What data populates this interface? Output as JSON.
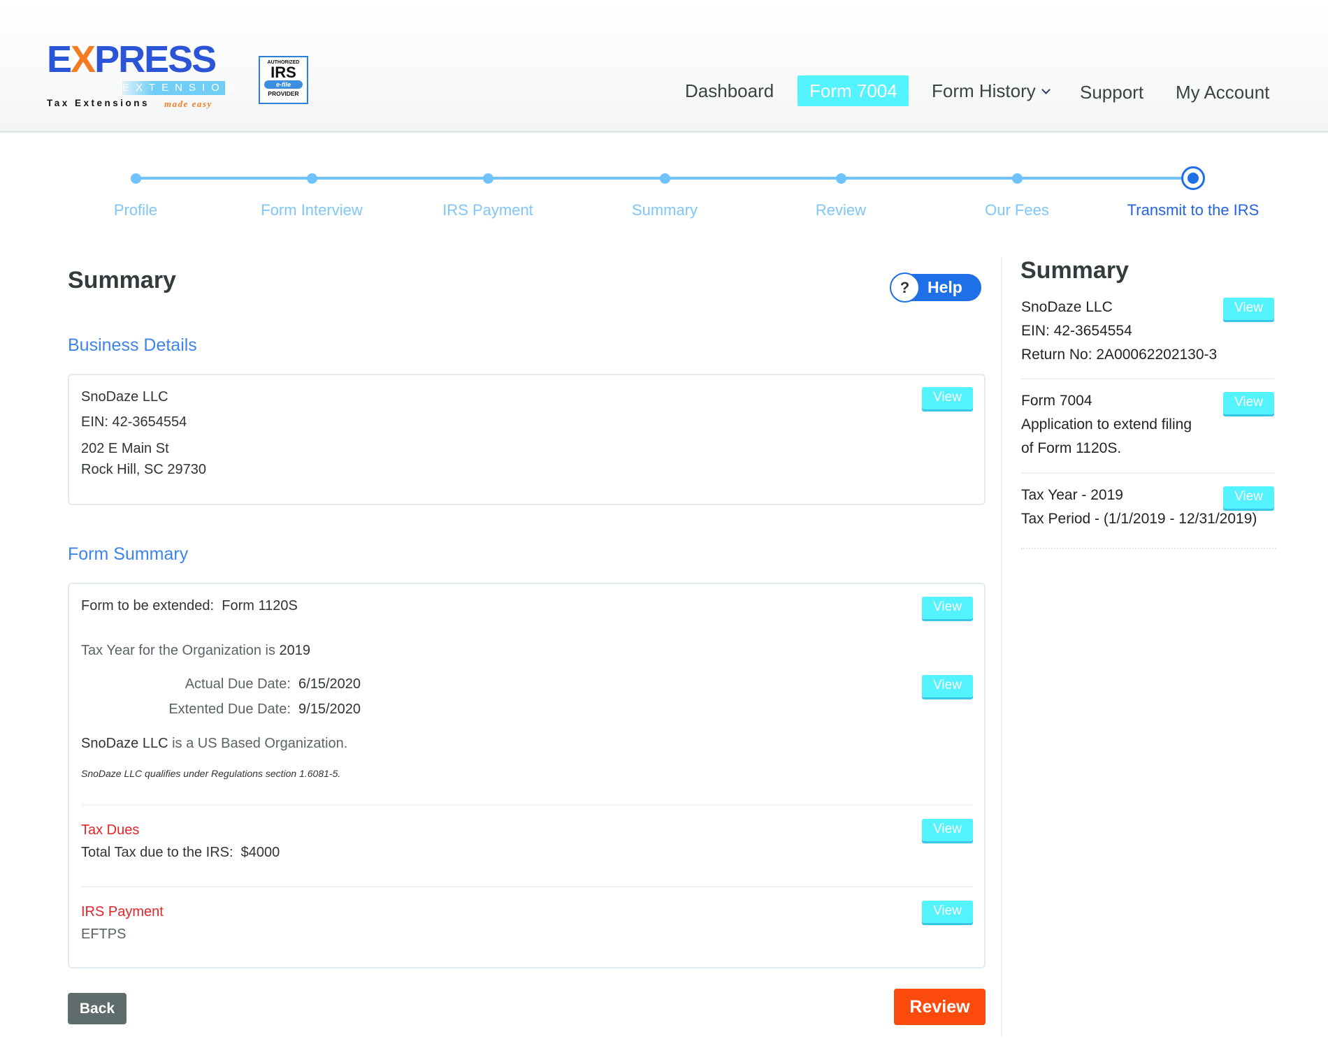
{
  "brand": {
    "logo_word_pre": "E",
    "logo_word_x": "X",
    "logo_word_post": "PRESS",
    "logo_sub": "EXTENSION",
    "logo_tagline": "Tax Extensions",
    "logo_tagline_script": "made easy",
    "irs_badge": {
      "line1": "AUTHORIZED",
      "line2": "IRS",
      "line3": "e-file",
      "line4": "PROVIDER"
    }
  },
  "nav": {
    "items": [
      {
        "label": "Dashboard",
        "active": false
      },
      {
        "label": "Form 7004",
        "active": true
      },
      {
        "label": "Form History",
        "active": false,
        "icon": "chevron-down-icon"
      },
      {
        "label": "Support",
        "active": false
      },
      {
        "label": "My Account",
        "active": false
      }
    ]
  },
  "stepper": {
    "steps": [
      {
        "label": "Profile",
        "state": "completed"
      },
      {
        "label": "Form Interview",
        "state": "completed"
      },
      {
        "label": "IRS Payment",
        "state": "completed"
      },
      {
        "label": "Summary",
        "state": "completed"
      },
      {
        "label": "Review",
        "state": "completed"
      },
      {
        "label": "Our Fees",
        "state": "completed"
      },
      {
        "label": "Transmit to the IRS",
        "state": "current"
      }
    ]
  },
  "main": {
    "title": "Summary",
    "help_label": "Help",
    "help_icon": "?",
    "business_details": {
      "heading": "Business Details",
      "name": "SnoDaze LLC",
      "ein": "EIN: 42-3654554",
      "address1": "202 E Main St",
      "address2": "Rock Hill, SC 29730",
      "view_label": "View"
    },
    "form_summary": {
      "heading": "Form Summary",
      "form_extended_label": "Form to be extended:",
      "form_extended_value": "Form 1120S",
      "tax_year_text": "Tax Year for the Organization is",
      "tax_year_value": "2019",
      "actual_due_label": "Actual Due Date:",
      "actual_due_value": "6/15/2020",
      "extended_due_label": "Extented Due Date:",
      "extended_due_value": "9/15/2020",
      "org_name": "SnoDaze LLC",
      "org_text": "is a US Based Organization.",
      "regulation_note": "SnoDaze LLC qualifies under Regulations section 1.6081-5.",
      "tax_dues_heading": "Tax Dues",
      "total_tax_label": "Total Tax due to the IRS:",
      "total_tax_value": "$4000",
      "irs_payment_heading": "IRS Payment",
      "irs_payment_value": "EFTPS",
      "view_label": "View"
    },
    "back_label": "Back",
    "review_label": "Review"
  },
  "sidebar": {
    "title": "Summary",
    "view_label": "View",
    "business": {
      "name": "SnoDaze LLC",
      "ein": "EIN: 42-3654554",
      "return_no": "Return No: 2A00062202130-3"
    },
    "form": {
      "title": "Form 7004",
      "line1": "Application to extend filing",
      "line2": "of Form 1120S."
    },
    "tax_year": {
      "title": "Tax Year - 2019",
      "period": "Tax Period - (1/1/2019 - 12/31/2019)"
    }
  },
  "colors": {
    "accent_cyan": "#52f3fd",
    "primary_blue": "#1f6fe6",
    "section_blue": "#3d84ee",
    "step_blue": "#6fc2fb",
    "alert_red": "#e3242b",
    "review_orange": "#fc4a0d",
    "back_gray": "#5e6d6c"
  }
}
